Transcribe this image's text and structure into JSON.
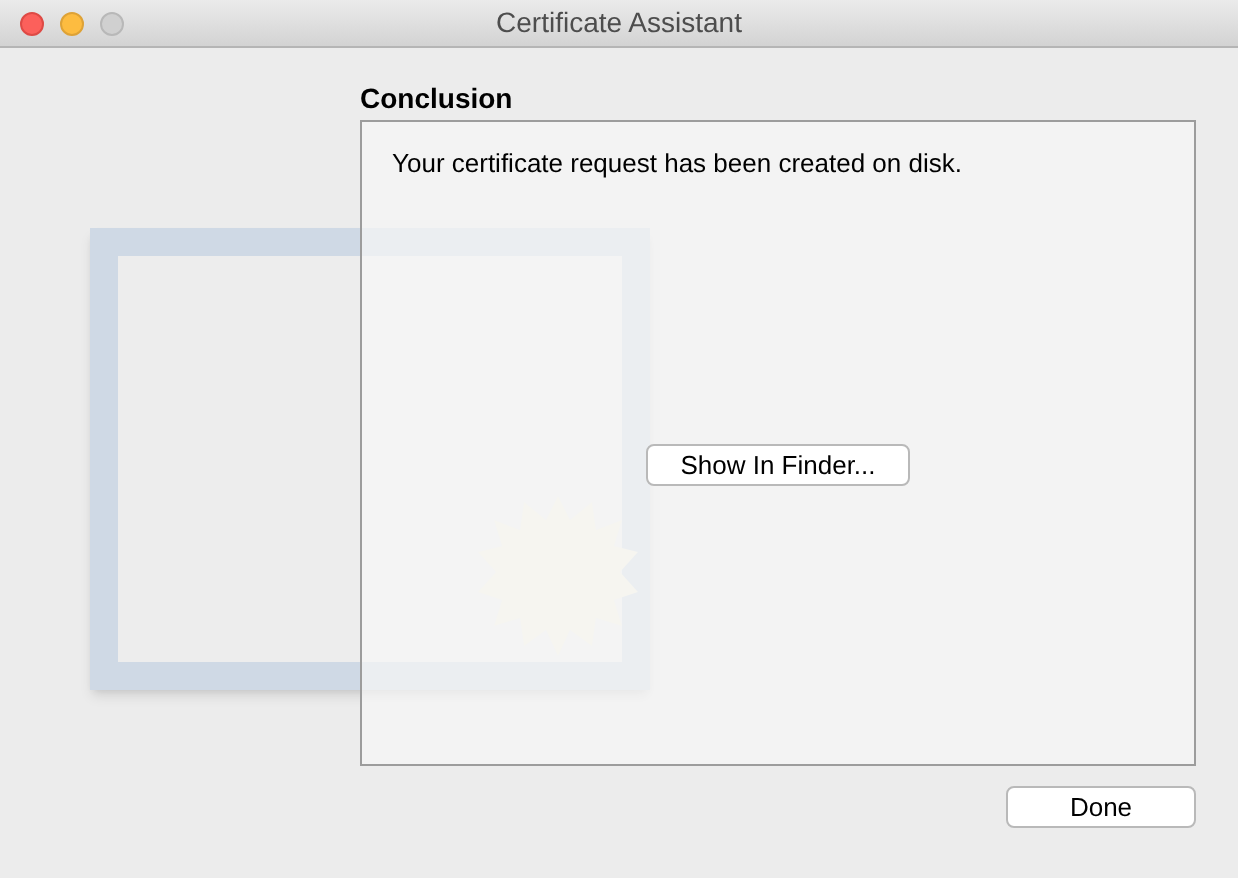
{
  "window": {
    "title": "Certificate Assistant"
  },
  "heading": "Conclusion",
  "message": "Your certificate request has been created on disk.",
  "buttons": [
    {
      "label": "Show In Finder...",
      "kind": "panel"
    },
    {
      "label": "Done",
      "kind": "footer"
    }
  ]
}
